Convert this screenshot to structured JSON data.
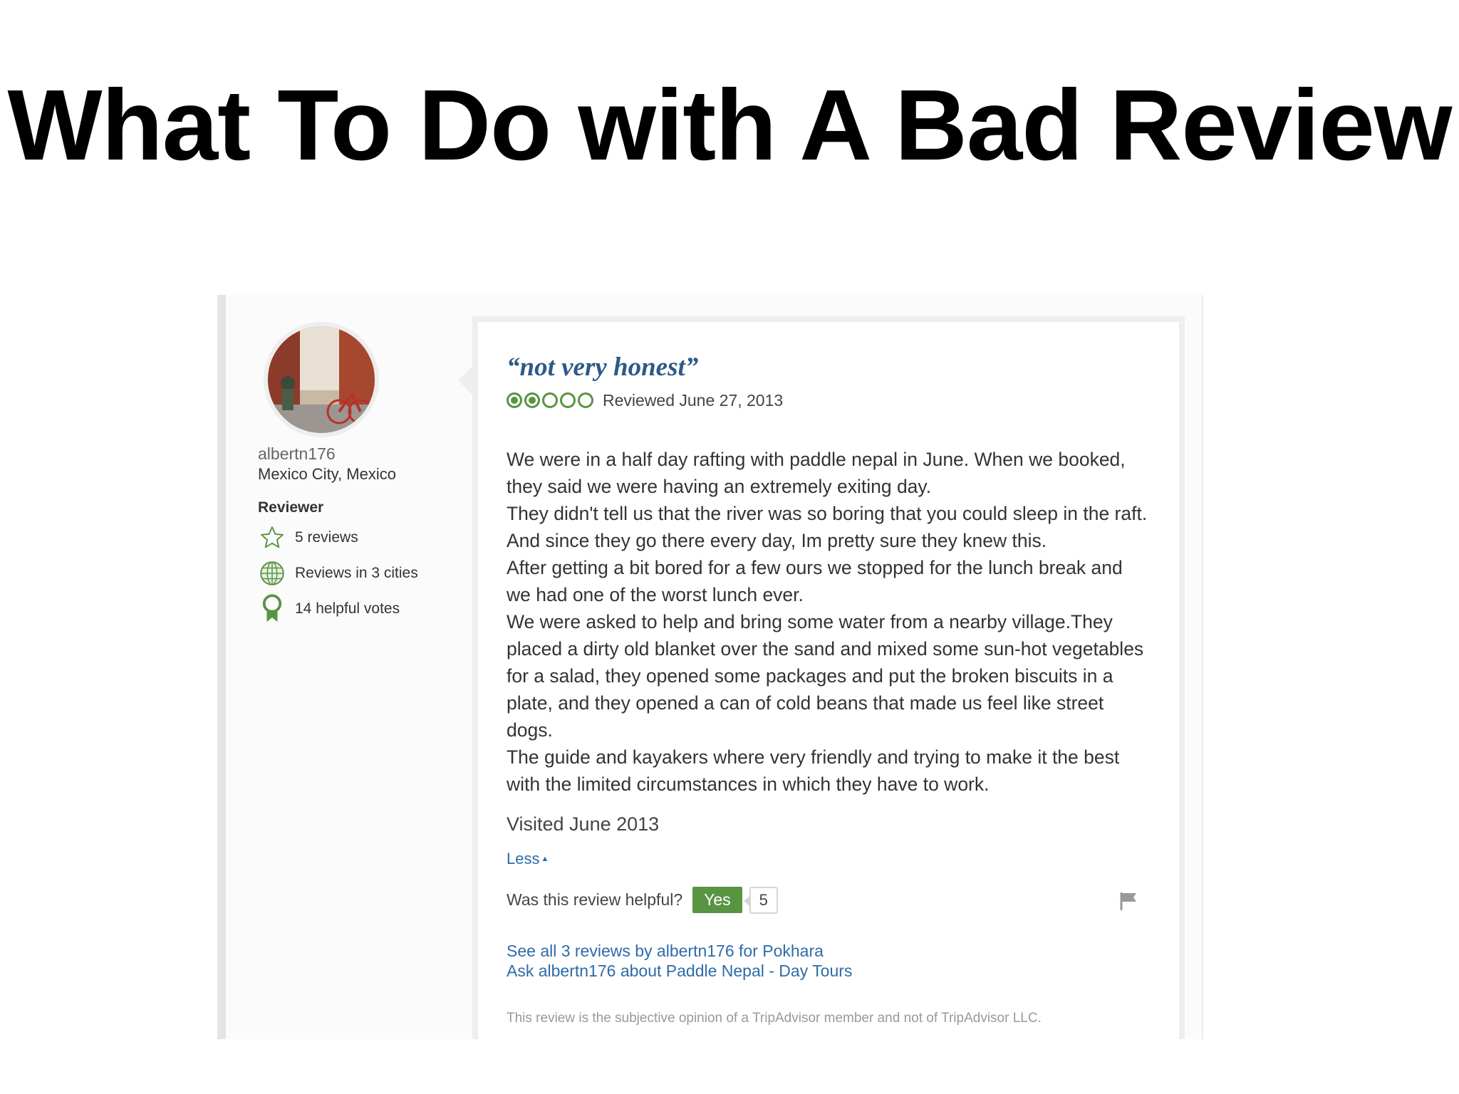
{
  "slide": {
    "title": "What To Do with A Bad Review"
  },
  "reviewer": {
    "username": "albertn176",
    "location": "Mexico City, Mexico",
    "badge": "Reviewer",
    "stats": [
      {
        "icon": "star-icon",
        "label": "5 reviews"
      },
      {
        "icon": "globe-icon",
        "label": "Reviews in 3 cities"
      },
      {
        "icon": "ribbon-icon",
        "label": "14 helpful votes"
      }
    ]
  },
  "review": {
    "title": "“not very honest”",
    "rating": 2,
    "rating_max": 5,
    "reviewed_date": "Reviewed June 27, 2013",
    "body": [
      "We were in a half day rafting with paddle nepal in June. When we booked, they said we were having an extremely exiting day.",
      "They didn't tell us that the river was so boring that you could sleep in the raft. And since they go there every day, Im pretty sure they knew this.",
      "After getting a bit bored for a few ours we stopped for the lunch break and we had one of the worst lunch ever.",
      "We were asked to help and bring some water from a nearby village.They placed a dirty old blanket over the sand and mixed some sun-hot vegetables for a salad, they opened some packages and put the broken biscuits in a plate, and they opened a can of cold beans that made us feel like street dogs.",
      "The guide and kayakers where very friendly and trying to make it the best with the limited circumstances in which they have to work."
    ],
    "visited": "Visited June 2013",
    "less_label": "Less",
    "helpful_question": "Was this review helpful?",
    "yes_label": "Yes",
    "helpful_count": "5",
    "link_see_all": "See all 3 reviews by albertn176 for Pokhara",
    "link_ask": "Ask albertn176 about Paddle Nepal - Day Tours",
    "disclaimer": "This review is the subjective opinion of a TripAdvisor member and not of TripAdvisor LLC."
  },
  "colors": {
    "accent_green": "#589442",
    "link_blue": "#2e6ba8",
    "title_blue": "#2e5a87"
  }
}
